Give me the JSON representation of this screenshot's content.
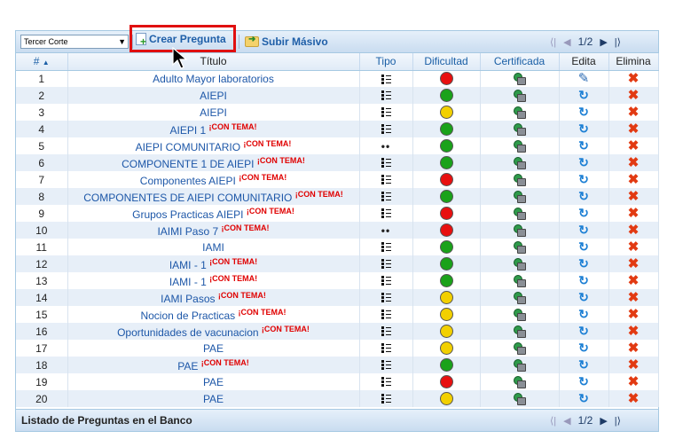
{
  "toolbar": {
    "corte_value": "Tercer Corte",
    "create_label": "Crear Pregunta",
    "upload_label": "Subir Másivo"
  },
  "pager": {
    "page": "1/2"
  },
  "columns": {
    "num": "#",
    "title": "Título",
    "type": "Tipo",
    "difficulty": "Dificultad",
    "certified": "Certificada",
    "edit": "Edita",
    "delete": "Elimina"
  },
  "tema_tag": "¡CON TEMA!",
  "colors": {
    "red": "#e81010",
    "green": "#1aa21a",
    "yellow": "#f2d000",
    "accent": "#1d57a8"
  },
  "rows": [
    {
      "n": "1",
      "title": "Adulto Mayor laboratorios",
      "tema": false,
      "type": "list",
      "difficulty": "red",
      "edit": "pencil"
    },
    {
      "n": "2",
      "title": "AIEPI",
      "tema": false,
      "type": "list",
      "difficulty": "green",
      "edit": "arrow"
    },
    {
      "n": "3",
      "title": "AIEPI",
      "tema": false,
      "type": "list",
      "difficulty": "yellow",
      "edit": "arrow"
    },
    {
      "n": "4",
      "title": "AIEPI 1",
      "tema": true,
      "type": "list",
      "difficulty": "green",
      "edit": "arrow"
    },
    {
      "n": "5",
      "title": "AIEPI COMUNITARIO",
      "tema": true,
      "type": "dots",
      "difficulty": "green",
      "edit": "arrow"
    },
    {
      "n": "6",
      "title": "COMPONENTE 1 DE AIEPI",
      "tema": true,
      "type": "list",
      "difficulty": "green",
      "edit": "arrow"
    },
    {
      "n": "7",
      "title": "Componentes AIEPI",
      "tema": true,
      "type": "list",
      "difficulty": "red",
      "edit": "arrow"
    },
    {
      "n": "8",
      "title": "COMPONENTES DE AIEPI COMUNITARIO",
      "tema": true,
      "type": "list",
      "difficulty": "green",
      "edit": "arrow"
    },
    {
      "n": "9",
      "title": "Grupos Practicas AIEPI",
      "tema": true,
      "type": "list",
      "difficulty": "red",
      "edit": "arrow"
    },
    {
      "n": "10",
      "title": "IAIMI Paso 7",
      "tema": true,
      "type": "dots",
      "difficulty": "red",
      "edit": "arrow"
    },
    {
      "n": "11",
      "title": "IAMI",
      "tema": false,
      "type": "list",
      "difficulty": "green",
      "edit": "arrow"
    },
    {
      "n": "12",
      "title": "IAMI - 1",
      "tema": true,
      "type": "list",
      "difficulty": "green",
      "edit": "arrow"
    },
    {
      "n": "13",
      "title": "IAMI - 1",
      "tema": true,
      "type": "list",
      "difficulty": "green",
      "edit": "arrow"
    },
    {
      "n": "14",
      "title": "IAMI Pasos",
      "tema": true,
      "type": "list",
      "difficulty": "yellow",
      "edit": "arrow"
    },
    {
      "n": "15",
      "title": "Nocion de Practicas",
      "tema": true,
      "type": "list",
      "difficulty": "yellow",
      "edit": "arrow"
    },
    {
      "n": "16",
      "title": "Oportunidades de vacunacion",
      "tema": true,
      "type": "list",
      "difficulty": "yellow",
      "edit": "arrow"
    },
    {
      "n": "17",
      "title": "PAE",
      "tema": false,
      "type": "list",
      "difficulty": "yellow",
      "edit": "arrow"
    },
    {
      "n": "18",
      "title": "PAE",
      "tema": true,
      "type": "list",
      "difficulty": "green",
      "edit": "arrow"
    },
    {
      "n": "19",
      "title": "PAE",
      "tema": false,
      "type": "list",
      "difficulty": "red",
      "edit": "arrow"
    },
    {
      "n": "20",
      "title": "PAE",
      "tema": false,
      "type": "list",
      "difficulty": "yellow",
      "edit": "arrow"
    }
  ],
  "footer": {
    "caption": "Listado de Preguntas en el Banco",
    "page": "1/2"
  }
}
